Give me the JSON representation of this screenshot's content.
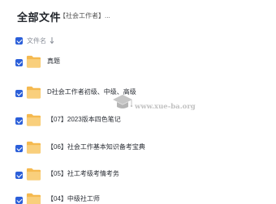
{
  "header": {
    "title": "全部文件",
    "breadcrumb": "【社会工作者】..."
  },
  "list": {
    "column_name": "文件名",
    "items": [
      {
        "label": "真题"
      },
      {
        "label": "D社会工作者初级、中级、高级"
      },
      {
        "label": "【07】2023版本四色笔记"
      },
      {
        "label": "【06】社会工作基本知识备考宝典"
      },
      {
        "label": "【05】社工考级考情考务"
      },
      {
        "label": "【04】中级社工师"
      }
    ]
  },
  "watermark": {
    "text": "www.xue-ba.org"
  },
  "colors": {
    "accent": "#2b5fd9",
    "folder": "#f7c46a"
  }
}
